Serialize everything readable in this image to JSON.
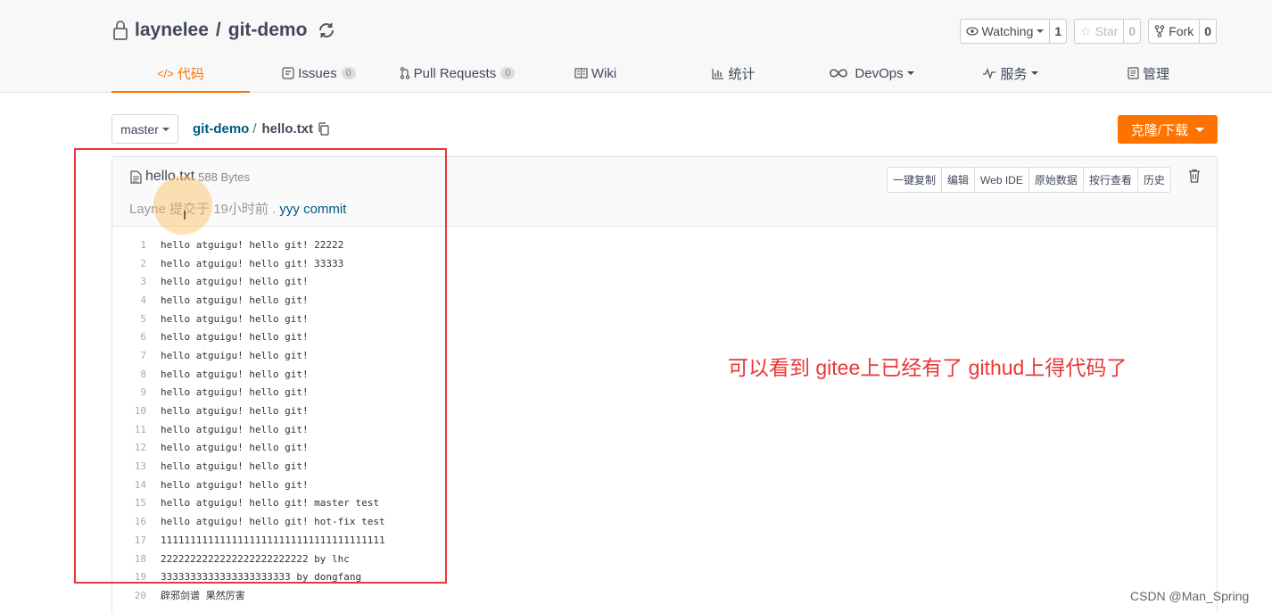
{
  "header": {
    "owner": "laynelee",
    "separator": "/",
    "repo": "git-demo",
    "watch": {
      "label": "Watching",
      "count": "1"
    },
    "star": {
      "label": "Star",
      "count": "0"
    },
    "fork": {
      "label": "Fork",
      "count": "0"
    }
  },
  "tabs": [
    {
      "icon": "</>",
      "label": "代码",
      "active": true
    },
    {
      "icon": "issues-icon",
      "label": "Issues",
      "count": "0"
    },
    {
      "icon": "pull-request-icon",
      "label": "Pull Requests",
      "count": "0"
    },
    {
      "icon": "wiki-icon",
      "label": "Wiki"
    },
    {
      "icon": "stats-icon",
      "label": "统计"
    },
    {
      "icon": "devops-icon",
      "label": "DevOps"
    },
    {
      "icon": "service-icon",
      "label": "服务"
    },
    {
      "icon": "manage-icon",
      "label": "管理"
    }
  ],
  "branch": "master",
  "breadcrumb": {
    "repo": "git-demo",
    "separator": "/",
    "file": "hello.txt"
  },
  "clone_label": "克隆/下载",
  "file": {
    "name": "hello.txt",
    "size": "588 Bytes",
    "author": "Layne",
    "committed_text": "提交于 19小时前 .",
    "commit_message": "yyy commit",
    "tools": [
      "一键复制",
      "编辑",
      "Web IDE",
      "原始数据",
      "按行查看",
      "历史"
    ]
  },
  "code_lines": [
    "hello atguigu! hello git! 22222",
    "hello atguigu! hello git! 33333",
    "hello atguigu! hello git!",
    "hello atguigu! hello git!",
    "hello atguigu! hello git!",
    "hello atguigu! hello git!",
    "hello atguigu! hello git!",
    "hello atguigu! hello git!",
    "hello atguigu! hello git!",
    "hello atguigu! hello git!",
    "hello atguigu! hello git!",
    "hello atguigu! hello git!",
    "hello atguigu! hello git!",
    "hello atguigu! hello git!",
    "hello atguigu! hello git! master test",
    "hello atguigu! hello git! hot-fix test",
    "11111111111111111111111111111111111111",
    "2222222222222222222222222 by lhc",
    "3333333333333333333333 by dongfang",
    "辟邪剑谱 果然厉害"
  ],
  "annotation": "可以看到 gitee上已经有了 githud上得代码了",
  "watermark": "CSDN @Man_Spring",
  "colors": {
    "accent": "#fe7300",
    "link": "#005980",
    "annotation": "#e8383a"
  }
}
